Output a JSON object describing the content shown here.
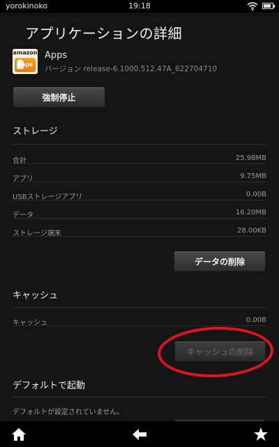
{
  "status_bar": {
    "carrier": "yorokinoko",
    "time": "19:18",
    "battery_level": 0.85
  },
  "header": {
    "title": "アプリケーションの詳細"
  },
  "app": {
    "name": "Apps",
    "version": "バージョン release-6.1000.512.47A_622704710",
    "icon_text_top": "amazon",
    "icon_text_badge": "apps"
  },
  "actions": {
    "force_stop_label": "強制停止"
  },
  "storage": {
    "title": "ストレージ",
    "rows": [
      {
        "label": "合計",
        "value": "25.98MB"
      },
      {
        "label": "アプリ",
        "value": "9.75MB"
      },
      {
        "label": "USBストレージアプリ",
        "value": "0.00B"
      },
      {
        "label": "データ",
        "value": "16.20MB"
      },
      {
        "label": "ストレージ端末",
        "value": "28.00KB"
      }
    ],
    "clear_data_label": "データの削除"
  },
  "cache": {
    "title": "キャッシュ",
    "rows": [
      {
        "label": "キャッシュ",
        "value": "0.00B"
      }
    ],
    "clear_cache_label": "キャッシュの削除"
  },
  "defaults": {
    "title": "デフォルトで起動",
    "note": "デフォルトが設定されていません。"
  },
  "icons": {
    "home": "home-icon",
    "back": "back-arrow-icon",
    "favorites": "star-icon",
    "wifi": "wifi-icon",
    "battery": "battery-icon"
  },
  "colors": {
    "background": "#141414",
    "annotation": "#e1141d"
  }
}
